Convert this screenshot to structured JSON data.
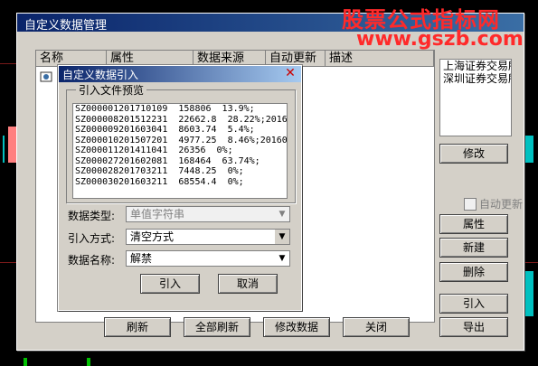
{
  "watermark": {
    "line1": "股票公式指标网",
    "line2": "www.gszb.com"
  },
  "outer_dialog": {
    "title": "自定义数据管理",
    "columns": [
      "名称",
      "属性",
      "数据来源",
      "自动更新",
      "描述"
    ],
    "right_list": [
      "上海证券交易所",
      "深圳证券交易所"
    ],
    "modify_label": "修改",
    "auto_update_label": "自动更新",
    "side_buttons": {
      "property": "属性",
      "new": "新建",
      "delete": "删除",
      "import": "引入",
      "export": "导出"
    },
    "bottom_buttons": {
      "refresh": "刷新",
      "refresh_all": "全部刷新",
      "modify_data": "修改数据",
      "close": "关闭"
    }
  },
  "import_dialog": {
    "title": "自定义数据引入",
    "preview_label": "引入文件预览",
    "preview_lines": [
      "SZ000001201710109  158806  13.9%;",
      "SZ000008201512231  22662.8  28.22%;20160",
      "SZ000009201603041  8603.74  5.4%;",
      "SZ000010201507201  4977.25  8.46%;201607",
      "SZ000011201411041  26356  0%;",
      "SZ000027201602081  168464  63.74%;",
      "SZ000028201703211  7448.25  0%;",
      "SZ000030201603211  68554.4  0%;"
    ],
    "data_type_label": "数据类型:",
    "data_type_value": "单值字符串",
    "import_mode_label": "引入方式:",
    "import_mode_value": "清空方式",
    "data_name_label": "数据名称:",
    "data_name_value": "解禁",
    "ok_label": "引入",
    "cancel_label": "取消"
  }
}
